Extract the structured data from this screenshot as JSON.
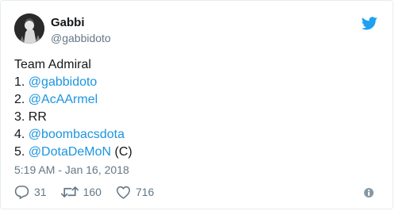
{
  "user": {
    "name": "Gabbi",
    "handle": "@gabbidoto"
  },
  "tweet": {
    "title_line": "Team Admiral",
    "lines": [
      {
        "prefix": "1. ",
        "mention": "@gabbidoto",
        "suffix": ""
      },
      {
        "prefix": "2. ",
        "mention": "@AcAArmel",
        "suffix": ""
      },
      {
        "prefix": "3. RR",
        "mention": "",
        "suffix": ""
      },
      {
        "prefix": "4. ",
        "mention": "@boombacsdota",
        "suffix": ""
      },
      {
        "prefix": "5. ",
        "mention": "@DotaDeMoN",
        "suffix": " (C)"
      }
    ],
    "timestamp": "5:19 AM - Jan 16, 2018"
  },
  "stats": {
    "replies": "31",
    "retweets": "160",
    "likes": "716"
  },
  "icons": {
    "brand": "twitter-bird-icon",
    "reply": "reply-icon",
    "retweet": "retweet-icon",
    "like": "heart-icon",
    "info": "info-icon"
  },
  "colors": {
    "brand": "#1da1f2",
    "mention": "#1b95e0",
    "text": "#14171a",
    "muted": "#657786"
  }
}
